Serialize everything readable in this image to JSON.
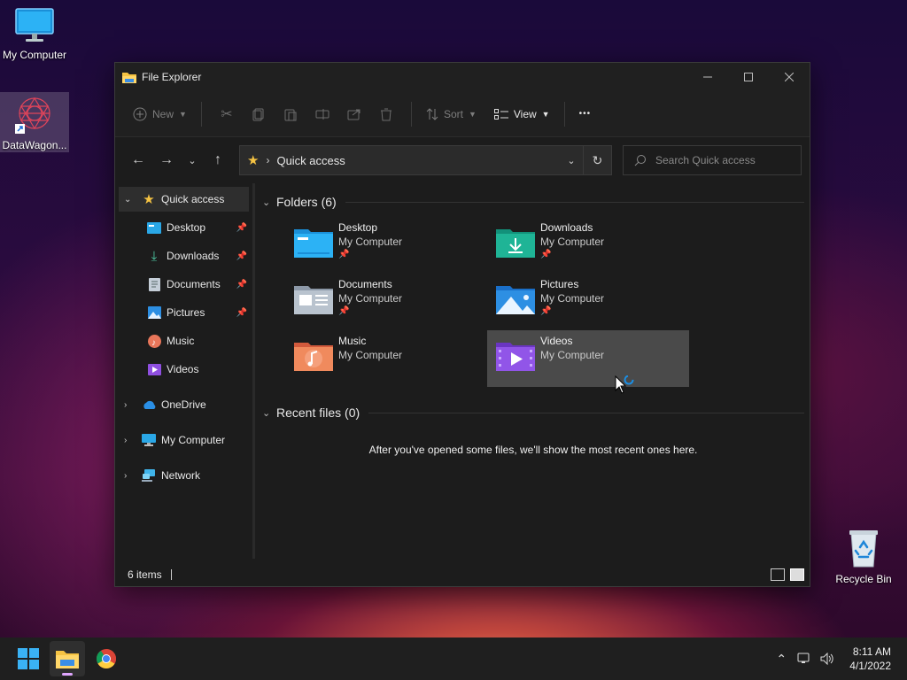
{
  "desktop": {
    "icons": [
      {
        "label": "My Computer"
      },
      {
        "label": "DataWagon..."
      },
      {
        "label": "Recycle Bin"
      }
    ]
  },
  "window": {
    "title": "File Explorer"
  },
  "toolbar": {
    "new_label": "New",
    "sort_label": "Sort",
    "view_label": "View",
    "more_label": "•••"
  },
  "navbar": {
    "address_location": "Quick access",
    "search_placeholder": "Search Quick access"
  },
  "sidebar": {
    "items": [
      {
        "label": "Quick access",
        "icon": "star-icon"
      },
      {
        "label": "Desktop",
        "icon": "desktop-folder-icon"
      },
      {
        "label": "Downloads",
        "icon": "download-icon"
      },
      {
        "label": "Documents",
        "icon": "documents-icon"
      },
      {
        "label": "Pictures",
        "icon": "pictures-icon"
      },
      {
        "label": "Music",
        "icon": "music-icon"
      },
      {
        "label": "Videos",
        "icon": "videos-icon"
      },
      {
        "label": "OneDrive",
        "icon": "cloud-icon"
      },
      {
        "label": "My Computer",
        "icon": "computer-icon"
      },
      {
        "label": "Network",
        "icon": "network-icon"
      }
    ]
  },
  "main": {
    "folders_header": "Folders (6)",
    "folders": [
      {
        "name": "Desktop",
        "location": "My Computer",
        "pinned": true
      },
      {
        "name": "Downloads",
        "location": "My Computer",
        "pinned": true
      },
      {
        "name": "Documents",
        "location": "My Computer",
        "pinned": true
      },
      {
        "name": "Pictures",
        "location": "My Computer",
        "pinned": true
      },
      {
        "name": "Music",
        "location": "My Computer",
        "pinned": false
      },
      {
        "name": "Videos",
        "location": "My Computer",
        "pinned": false
      }
    ],
    "recent_header": "Recent files (0)",
    "recent_empty_message": "After you've opened some files, we'll show the most recent ones here."
  },
  "statusbar": {
    "item_count": "6 items"
  },
  "taskbar": {
    "time": "8:11 AM",
    "date": "4/1/2022"
  },
  "colors": {
    "window_bg": "#1c1c1c",
    "accent": "#0078d4",
    "selected_tile": "#4a4a4a"
  }
}
